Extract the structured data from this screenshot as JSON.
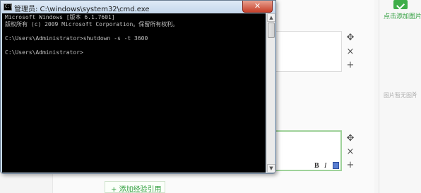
{
  "cmd": {
    "title": "管理员: C:\\windows\\system32\\cmd.exe",
    "close_label": "✕",
    "lines": [
      "Microsoft Windows [版本 6.1.7601]",
      "版权所有 (c) 2009 Microsoft Corporation。保留所有权利。",
      "",
      "C:\\Users\\Administrator>shutdown -s -t 3600",
      "",
      "C:\\Users\\Administrator>"
    ],
    "scroll_up": "▲",
    "scroll_down": "▼"
  },
  "editor": {
    "move_icon": "✥",
    "delete_icon": "×",
    "add_icon": "+",
    "bold_label": "B",
    "italic_label": "I",
    "add_reference_label": "+ 添加经验引用"
  },
  "sidebar": {
    "add_picture_label": "点击添加图片",
    "no_picture_label": "图片暂无图片",
    "no_picture_close": "✕"
  }
}
